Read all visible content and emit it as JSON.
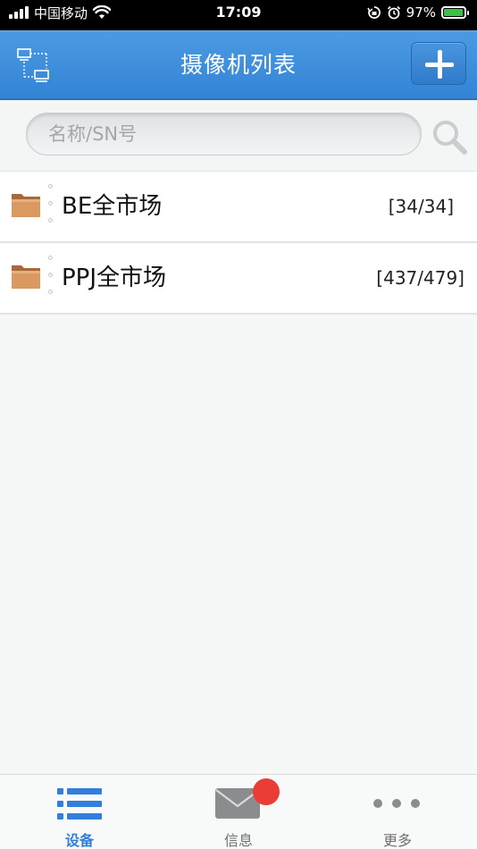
{
  "status_bar": {
    "carrier": "中国移动",
    "time": "17:09",
    "battery": "97%",
    "battery_level": 0.97
  },
  "header": {
    "title": "摄像机列表",
    "left_icon": "device-tree-icon",
    "right_icon": "plus-icon"
  },
  "search": {
    "placeholder": "名称/SN号",
    "value": ""
  },
  "list": {
    "items": [
      {
        "name": "BE全市场",
        "count": "[34/34]",
        "icon": "folder-icon"
      },
      {
        "name": "PPJ全市场",
        "count": "[437/479]",
        "icon": "folder-icon"
      }
    ]
  },
  "tabs": [
    {
      "label": "设备",
      "icon": "list-icon",
      "active": true
    },
    {
      "label": "信息",
      "icon": "mail-icon",
      "active": false
    },
    {
      "label": "更多",
      "icon": "more-icon",
      "active": false
    }
  ],
  "colors": {
    "header": "#3a8bdc",
    "active_tab": "#2f7fdb",
    "badge": "#ea3d35",
    "folder": "#d4935c"
  }
}
